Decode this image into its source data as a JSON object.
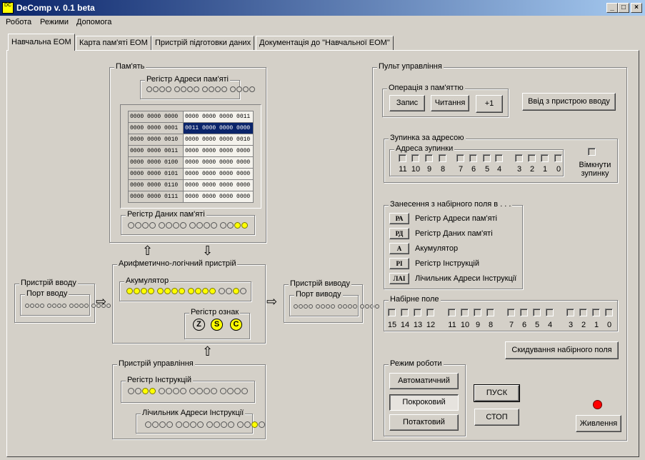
{
  "window": {
    "title": "DeComp v. 0.1 beta",
    "icon_text": "DC",
    "controls": [
      "_",
      "□",
      "×"
    ]
  },
  "menu": [
    "Робота",
    "Режими",
    "Допомога"
  ],
  "tabs": [
    {
      "label": "Навчальна ЕОМ"
    },
    {
      "label": "Карта пам'яті ЕОМ"
    },
    {
      "label": "Пристрій підготовки даних"
    },
    {
      "label": "Документація до \"Навчальної ЕОМ\""
    }
  ],
  "memory": {
    "title": "Пам'ять",
    "address_register": {
      "title": "Регістр Адреси  пам'яті",
      "bits": "0000000000000000"
    },
    "table": [
      {
        "addr": "0000 0000 0000",
        "val": "0000 0000 0000 0011"
      },
      {
        "addr": "0000 0000 0001",
        "val": "0011 0000 0000 0000"
      },
      {
        "addr": "0000 0000 0010",
        "val": "0000 0000 0000 0010"
      },
      {
        "addr": "0000 0000 0011",
        "val": "0000 0000 0000 0000"
      },
      {
        "addr": "0000 0000 0100",
        "val": "0000 0000 0000 0000"
      },
      {
        "addr": "0000 0000 0101",
        "val": "0000 0000 0000 0000"
      },
      {
        "addr": "0000 0000 0110",
        "val": "0000 0000 0000 0000"
      },
      {
        "addr": "0000 0000 0111",
        "val": "0000 0000 0000 0000"
      }
    ],
    "data_register": {
      "title": "Регістр Даних пам'яті",
      "bits": "0000000000000011"
    }
  },
  "alu": {
    "title": "Арифметично-логічний пристрій",
    "accumulator": {
      "title": "Акумулятор",
      "bits": "1111111111110010"
    },
    "flags": {
      "title": "Регістр ознак",
      "items": [
        {
          "label": "Z",
          "on": false
        },
        {
          "label": "S",
          "on": true
        },
        {
          "label": "C",
          "on": true
        }
      ]
    }
  },
  "input_device": {
    "title": "Пристрій вводу",
    "port_title": "Порт вводу",
    "bits": "0000000000000000"
  },
  "output_device": {
    "title": "Пристрій виводу",
    "port_title": "Порт виводу",
    "bits": "0000000000000000"
  },
  "control_unit": {
    "title": "Пристрій управління",
    "instruction_register": {
      "title": "Регістр Інструкцій",
      "bits": "0011000000000000"
    },
    "instruction_counter": {
      "title": "Лічильник Адреси Інструкції",
      "bits": "0000000000000010"
    }
  },
  "console": {
    "title": "Пульт управління",
    "mem_ops": {
      "title": "Операція з пам'яттю",
      "buttons": [
        "Запис",
        "Читання",
        "+1"
      ]
    },
    "input_button": "Ввід з пристрою вводу",
    "breakpoint": {
      "title": "Зупинка за адресою",
      "address_title": "Адреса зупинки",
      "bit_labels": [
        "11",
        "10",
        "9",
        "8",
        "7",
        "6",
        "5",
        "4",
        "3",
        "2",
        "1",
        "0"
      ],
      "enable_label": "Вімкнути зупинку",
      "enable_line1": "Вімкнути",
      "enable_line2": "зупинку"
    },
    "load": {
      "title": "Занесення з набірного поля в . . .",
      "items": [
        {
          "code": "РА",
          "label": "Регістр Адреси  пам'яті"
        },
        {
          "code": "РД",
          "label": "Регістр Даних пам'яті"
        },
        {
          "code": "А",
          "label": "Акумулятор"
        },
        {
          "code": "РІ",
          "label": "Регістр Інструкцій"
        },
        {
          "code": "ЛАІ",
          "label": "Лічильник Адреси Інструкції"
        }
      ]
    },
    "switches": {
      "title": "Набірне поле",
      "bit_labels": [
        "15",
        "14",
        "13",
        "12",
        "11",
        "10",
        "9",
        "8",
        "7",
        "6",
        "5",
        "4",
        "3",
        "2",
        "1",
        "0"
      ],
      "reset_button": "Скидування набірного поля"
    },
    "mode": {
      "title": "Режим роботи",
      "buttons": [
        "Автоматичний",
        "Покроковий",
        "Потактовий"
      ],
      "selected": "Покроковий"
    },
    "start_button": "ПУСК",
    "stop_button": "СТОП",
    "power_button": "Живлення",
    "power_led_color": "#ff0000"
  },
  "colors": {
    "led_on": "#ffff00",
    "selected_row": "#0a246a",
    "title_bar": "#0a246a"
  }
}
